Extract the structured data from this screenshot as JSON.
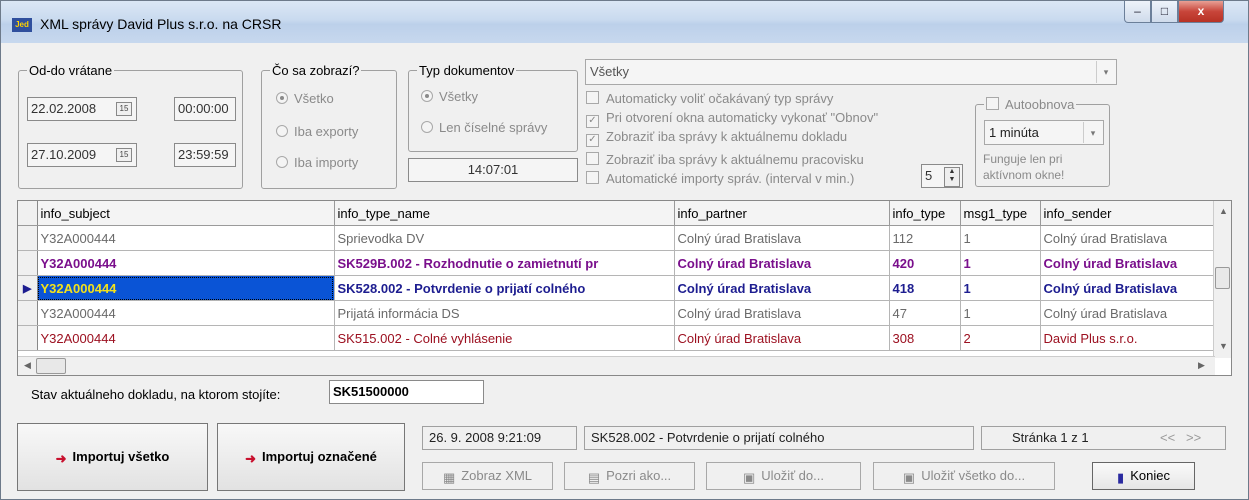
{
  "window": {
    "title": "XML správy David Plus s.r.o. na CRSR",
    "controls": {
      "minimize": "–",
      "maximize": "□",
      "close": "x"
    }
  },
  "filters": {
    "date_range": {
      "caption": "Od-do vrátane",
      "from_date": "22.02.2008",
      "from_time": "00:00:00",
      "to_date": "27.10.2009",
      "to_time": "23:59:59",
      "calendar_btn": "15"
    },
    "display": {
      "caption": "Čo sa zobrazí?",
      "options": [
        "Všetko",
        "Iba exporty",
        "Iba importy"
      ],
      "selected": "Všetko"
    },
    "doc_type": {
      "caption": "Typ dokumentov",
      "options": [
        "Všetky",
        "Len číselné správy"
      ],
      "selected": "Všetky",
      "clock": "14:07:01"
    },
    "type_combo": {
      "value": "Všetky",
      "arrow": "▾"
    },
    "checks": [
      {
        "label": "Automaticky voliť očakávaný typ správy",
        "checked": false
      },
      {
        "label": "Pri otvorení okna automaticky vykonať \"Obnov\"",
        "checked": true
      },
      {
        "label": "Zobraziť iba správy k aktuálnemu dokladu",
        "checked": true
      },
      {
        "label": "Zobraziť iba správy k aktuálnemu pracovisku",
        "checked": false
      },
      {
        "label": "Automatické importy správ. (interval v min.)",
        "checked": false
      }
    ],
    "interval_value": "5",
    "autorefresh": {
      "caption": "Autoobnova",
      "interval": "1 minúta",
      "note": "Funguje len pri aktívnom okne!"
    }
  },
  "grid": {
    "columns": [
      "info_subject",
      "info_type_name",
      "info_partner",
      "info_type",
      "msg1_type",
      "info_sender"
    ],
    "rows": [
      {
        "style": "gray",
        "cells": [
          "Y32A000444",
          "Sprievodka DV",
          "Colný úrad Bratislava",
          "112",
          "1",
          "Colný úrad Bratislava"
        ]
      },
      {
        "style": "purple",
        "cells": [
          "Y32A000444",
          "SK529B.002 - Rozhodnutie o zamietnutí pr",
          "Colný úrad Bratislava",
          "420",
          "1",
          "Colný úrad Bratislava"
        ]
      },
      {
        "style": "blue",
        "cells": [
          "Y32A000444",
          "SK528.002 - Potvrdenie o prijatí colného",
          "Colný úrad Bratislava",
          "418",
          "1",
          "Colný úrad Bratislava"
        ]
      },
      {
        "style": "gray",
        "cells": [
          "Y32A000444",
          "Prijatá informácia DS",
          "Colný úrad Bratislava",
          "47",
          "1",
          "Colný úrad Bratislava"
        ]
      },
      {
        "style": "red",
        "cells": [
          "Y32A000444",
          "SK515.002 - Colné vyhlásenie",
          "Colný úrad Bratislava",
          "308",
          "2",
          "David Plus s.r.o."
        ]
      }
    ]
  },
  "status": {
    "label": "Stav aktuálneho dokladu, na ktorom stojíte:",
    "value": "SK51500000"
  },
  "footer": {
    "import_all": "Importuj všetko",
    "import_selected": "Importuj označené",
    "timestamp": "26. 9. 2008 9:21:09",
    "message": "SK528.002 - Potvrdenie o prijatí colného",
    "page": "Stránka 1 z 1",
    "page_nav": "<<   >>",
    "buttons": {
      "show_xml": "Zobraz XML",
      "view_as": "Pozri ako...",
      "save_to": "Uložiť do...",
      "save_all": "Uložiť všetko do...",
      "close": "Koniec"
    }
  }
}
